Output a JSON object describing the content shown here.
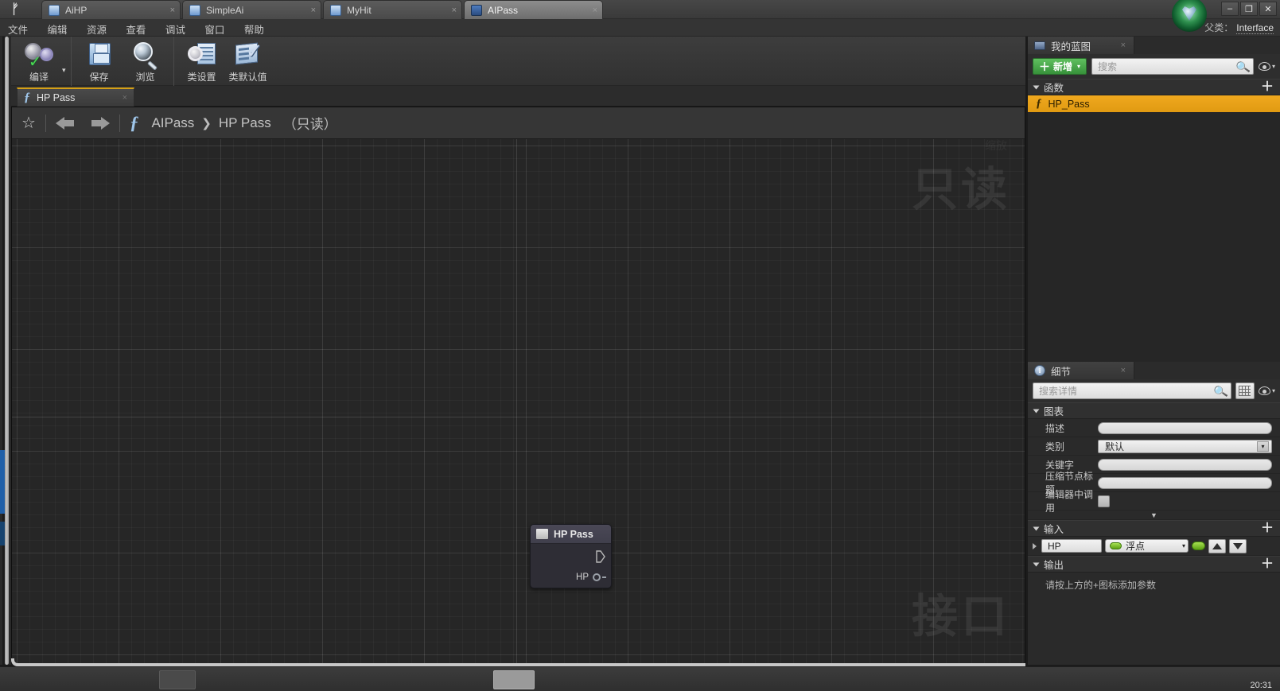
{
  "window": {
    "tabs": [
      {
        "label": "AiHP",
        "icon": "blueprint-actor-icon",
        "active": false,
        "close": "×"
      },
      {
        "label": "SimpleAi",
        "icon": "blueprint-character-icon",
        "active": false,
        "close": "×"
      },
      {
        "label": "MyHit",
        "icon": "blueprint-actor-icon",
        "active": false,
        "close": "×"
      },
      {
        "label": "AIPass",
        "icon": "blueprint-interface-icon",
        "active": true,
        "close": "×"
      }
    ],
    "controls": {
      "minimize": "–",
      "maximize": "❐",
      "close": "✕"
    },
    "logo": "ᚠ"
  },
  "menubar": {
    "items": [
      "文件",
      "编辑",
      "资源",
      "查看",
      "调试",
      "窗口",
      "帮助"
    ]
  },
  "parent_class": {
    "label": "父类：",
    "value": "Interface"
  },
  "toolbar": {
    "groups": [
      {
        "buttons": [
          {
            "label": "编译",
            "icon": "compile-icon",
            "has_dropdown": true,
            "caret": "▾"
          }
        ]
      },
      {
        "buttons": [
          {
            "label": "保存",
            "icon": "save-icon"
          },
          {
            "label": "浏览",
            "icon": "browse-icon"
          }
        ]
      },
      {
        "buttons": [
          {
            "label": "类设置",
            "icon": "class-settings-icon"
          },
          {
            "label": "类默认值",
            "icon": "class-defaults-icon"
          }
        ]
      }
    ]
  },
  "function_tab": {
    "label": "HP Pass",
    "fx": "ƒ",
    "close": "×"
  },
  "graph_header": {
    "star": "☆",
    "back_icon": "back-arrow-icon",
    "forward_icon": "forward-arrow-icon",
    "fx": "ƒ",
    "breadcrumb": [
      "AIPass",
      "HP Pass"
    ],
    "separator": "❯",
    "readonly": "（只读）"
  },
  "graph": {
    "zoom_label": "缩放",
    "watermark_readonly": "只读",
    "watermark_interface": "接口",
    "node": {
      "title": "HP Pass",
      "exec_pin": "exec-output-pin",
      "data_pin_label": "HP"
    }
  },
  "my_blueprint": {
    "tab": {
      "title": "我的蓝图",
      "icon": "book-icon",
      "close": "×"
    },
    "add_button": {
      "label": "新增",
      "plus": "＋",
      "caret": "▾"
    },
    "search": {
      "placeholder": "搜索",
      "value": "",
      "icon": "search-icon"
    },
    "eye_button": {
      "icon": "eye-icon",
      "caret": "▾"
    },
    "sections": [
      {
        "title": "函数",
        "add": "＋",
        "items": [
          {
            "label": "HP_Pass",
            "fx": "ƒ",
            "selected": true
          }
        ]
      }
    ]
  },
  "details": {
    "tab": {
      "title": "细节",
      "icon": "info-icon",
      "close": "×"
    },
    "search": {
      "placeholder": "搜索详情",
      "value": "",
      "icon": "search-icon"
    },
    "grid_button": "grid-view-icon",
    "eye_button": {
      "icon": "eye-icon",
      "caret": "▾"
    },
    "graph_section": {
      "title": "图表",
      "rows": [
        {
          "name": "描述",
          "type": "text",
          "value": ""
        },
        {
          "name": "类别",
          "type": "select",
          "value": "默认",
          "caret": "▾"
        },
        {
          "name": "关键字",
          "type": "text",
          "value": ""
        },
        {
          "name": "压缩节点标题",
          "type": "text",
          "value": ""
        },
        {
          "name": "编辑器中调用",
          "type": "checkbox",
          "value": ""
        }
      ],
      "expander": "▼"
    },
    "inputs": {
      "title": "输入",
      "add": "＋",
      "rows": [
        {
          "name": "HP",
          "type": "浮点",
          "caret": "▾",
          "move_up": "▲",
          "move_down": "▼"
        }
      ]
    },
    "outputs": {
      "title": "输出",
      "add": "＋",
      "hint": "请按上方的+图标添加参数"
    }
  },
  "taskbar": {
    "clock": "20:31"
  },
  "colors": {
    "accent_orange": "#f0a81e",
    "accent_green": "#4ddc50",
    "float_pin_green": "#5da213",
    "function_tab_underline": "#d4a017"
  }
}
